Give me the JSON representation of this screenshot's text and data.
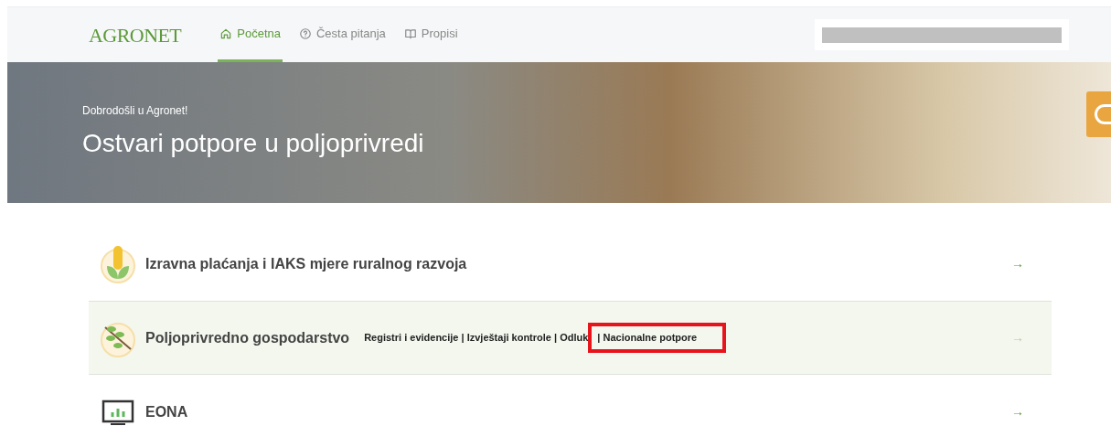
{
  "header": {
    "logo": "AGRONET",
    "nav": [
      {
        "label": "Početna",
        "kind": "home",
        "selected": true
      },
      {
        "label": "Česta pitanja",
        "kind": "help",
        "selected": false
      },
      {
        "label": "Propisi",
        "kind": "book",
        "selected": false
      }
    ]
  },
  "hero": {
    "greeting": "Dobrodošli u Agronet!",
    "title": "Ostvari potpore u poljoprivredi"
  },
  "rows": [
    {
      "title": "Izravna plaćanja i IAKS mjere ruralnog razvoja",
      "kind": "corn",
      "selected": false,
      "arrow": "→",
      "links": []
    },
    {
      "title": "Poljoprivredno gospodarstvo",
      "kind": "branch",
      "selected": true,
      "arrow": "→",
      "links": [
        {
          "text": "Registri i evidencije | Izvještaji kontrole | Odluk",
          "highlighted": false
        },
        {
          "text": "| Nacionalne potpore",
          "highlighted": true
        }
      ]
    },
    {
      "title": "EONA",
      "kind": "chart",
      "selected": false,
      "arrow": "→",
      "links": []
    }
  ]
}
